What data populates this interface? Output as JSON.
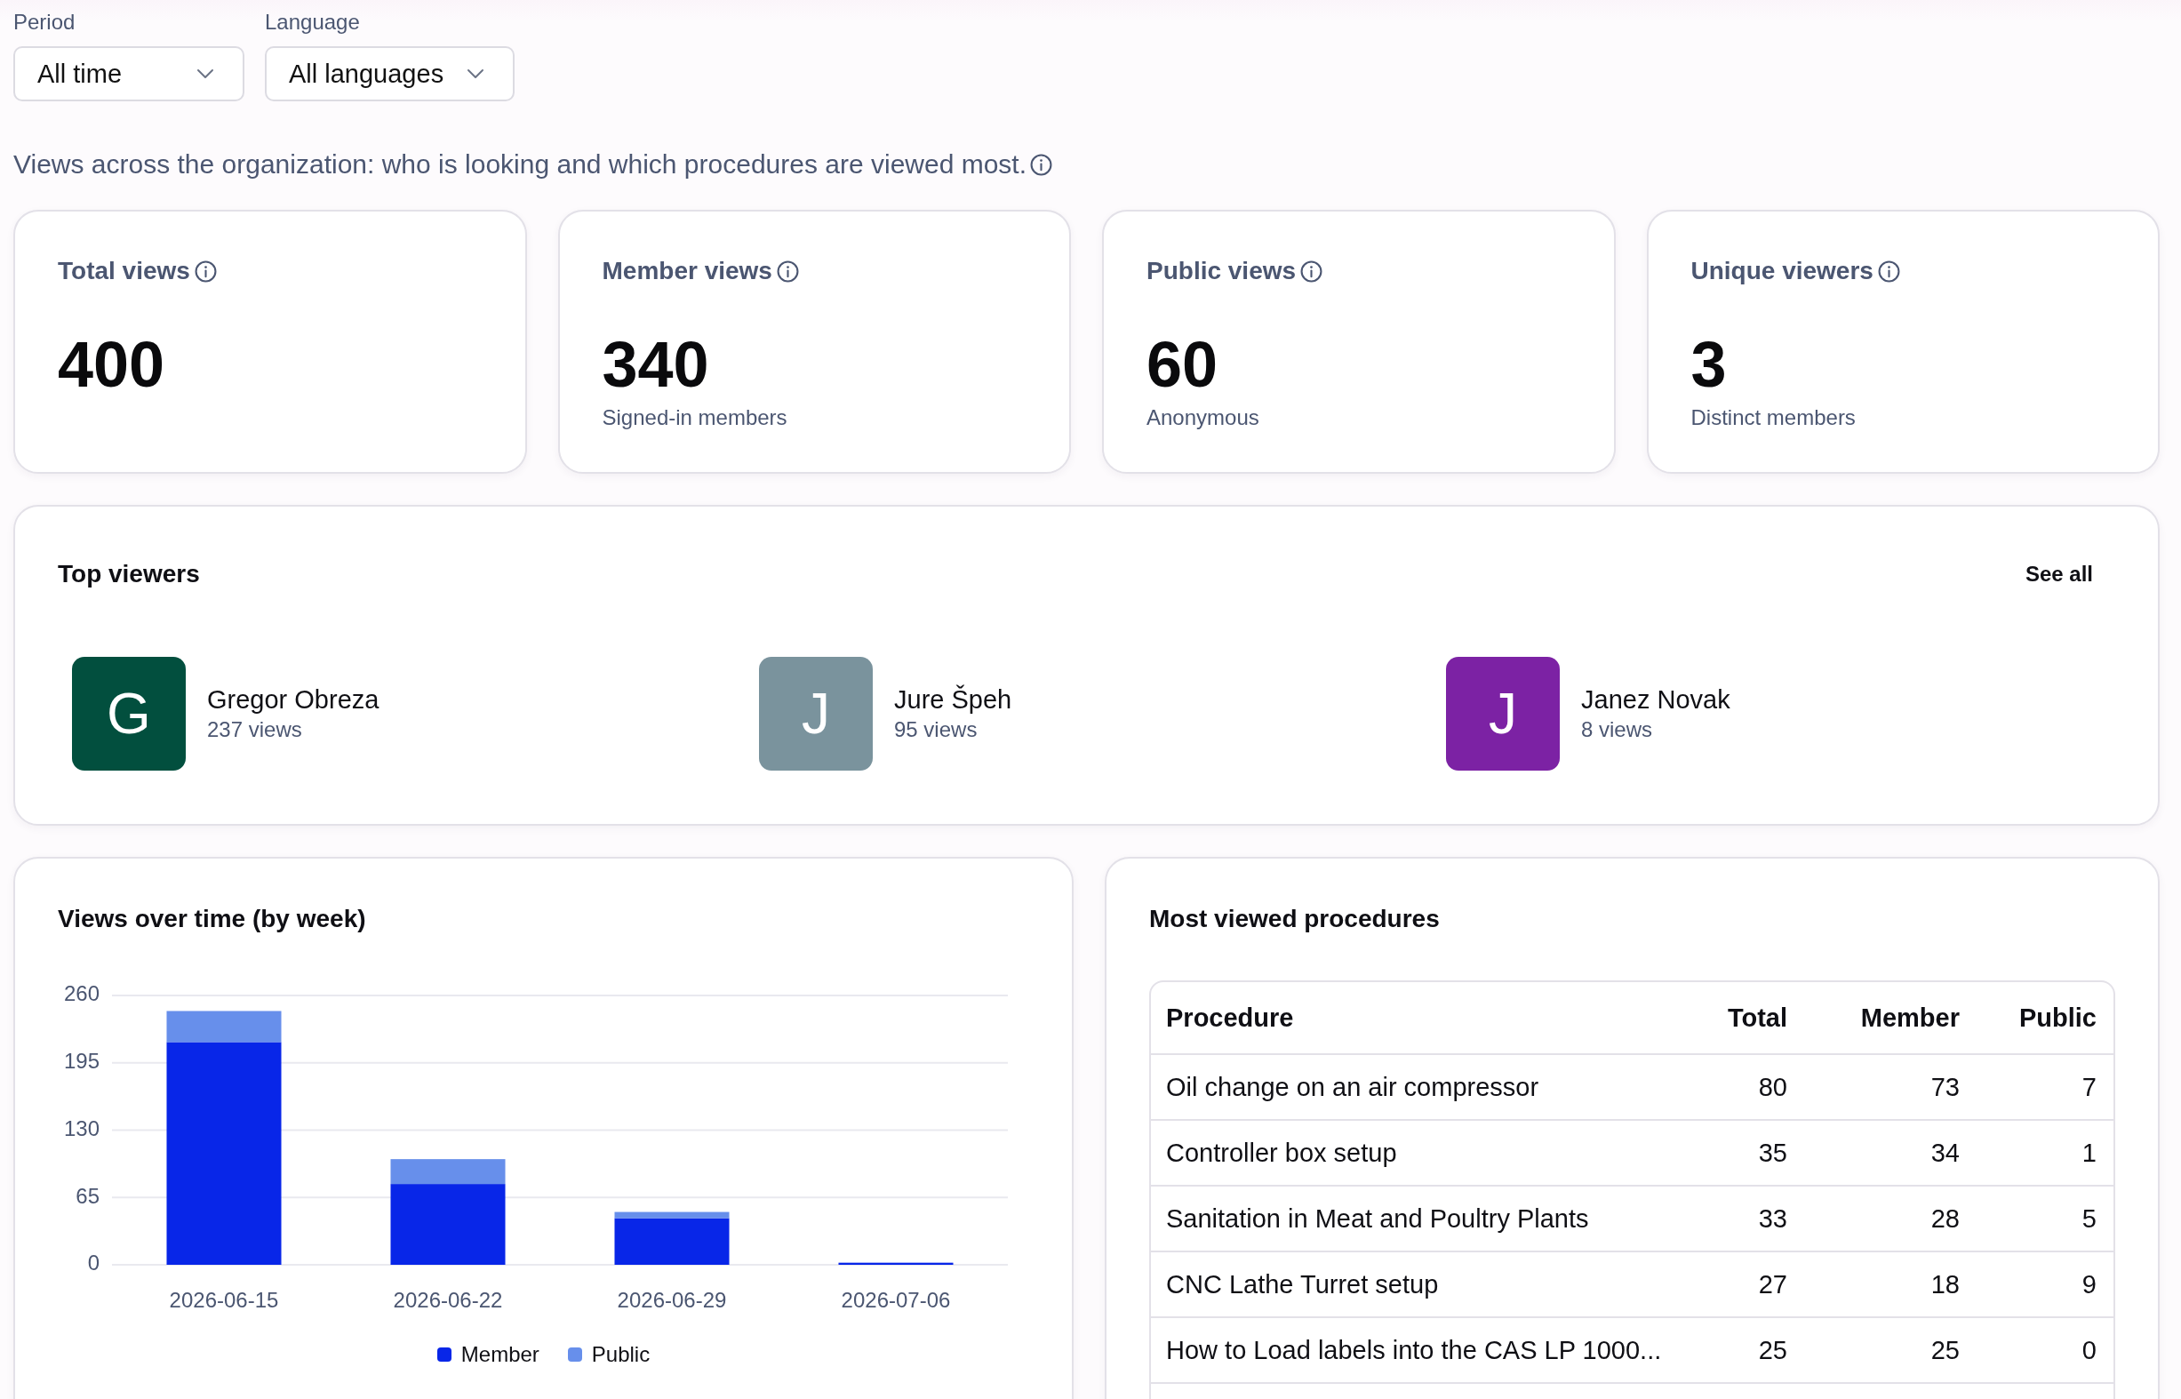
{
  "filters": [
    {
      "label": "Period",
      "value": "All time"
    },
    {
      "label": "Language",
      "value": "All languages"
    }
  ],
  "description": "Views across the organization: who is looking and which procedures are viewed most.",
  "stats": [
    {
      "title": "Total views",
      "value": "400"
    },
    {
      "title": "Member views",
      "value": "340",
      "caption": "Signed-in members"
    },
    {
      "title": "Public views",
      "value": "60",
      "caption": "Anonymous"
    },
    {
      "title": "Unique viewers",
      "value": "3",
      "caption": "Distinct members"
    }
  ],
  "top_viewers": {
    "title": "Top viewers",
    "link": "See all",
    "viewers": [
      {
        "initial": "G",
        "name": "Gregor Obreza",
        "views": "237 views",
        "color": "#024f3e"
      },
      {
        "initial": "J",
        "name": "Jure Špeh",
        "views": "95 views",
        "color": "#7a939d"
      },
      {
        "initial": "J",
        "name": "Janez Novak",
        "views": "8 views",
        "color": "#7c22a4"
      }
    ]
  },
  "views_over_time": {
    "chart_data": {
      "type": "bar",
      "title": "Views over time (by week)",
      "categories": [
        "2026-06-15",
        "2026-06-22",
        "2026-06-29",
        "2026-07-06"
      ],
      "series": [
        {
          "name": "Member",
          "color": "#0826e8",
          "values": [
            215,
            78,
            45,
            2
          ]
        },
        {
          "name": "Public",
          "color": "#678feb",
          "values": [
            30,
            24,
            6,
            0
          ]
        }
      ],
      "stacked": true,
      "grid": true,
      "legend": "bottom",
      "ylim": [
        0,
        260
      ],
      "yticks": [
        {
          "value": 0,
          "label": "0"
        },
        {
          "value": 65,
          "label": "65"
        },
        {
          "value": 130,
          "label": "130"
        },
        {
          "value": 195,
          "label": "195"
        },
        {
          "value": 260,
          "label": "260"
        }
      ]
    }
  },
  "most_viewed": {
    "title": "Most viewed procedures",
    "columns": [
      "Procedure",
      "Total",
      "Member",
      "Public"
    ],
    "rows": [
      [
        "Oil change on an air compressor",
        "80",
        "73",
        "7"
      ],
      [
        "Controller box setup",
        "35",
        "34",
        "1"
      ],
      [
        "Sanitation in Meat and Poultry Plants",
        "33",
        "28",
        "5"
      ],
      [
        "CNC Lathe Turret setup",
        "27",
        "18",
        "9"
      ],
      [
        "How to Load labels into the CAS LP 1000...",
        "25",
        "25",
        "0"
      ]
    ]
  }
}
